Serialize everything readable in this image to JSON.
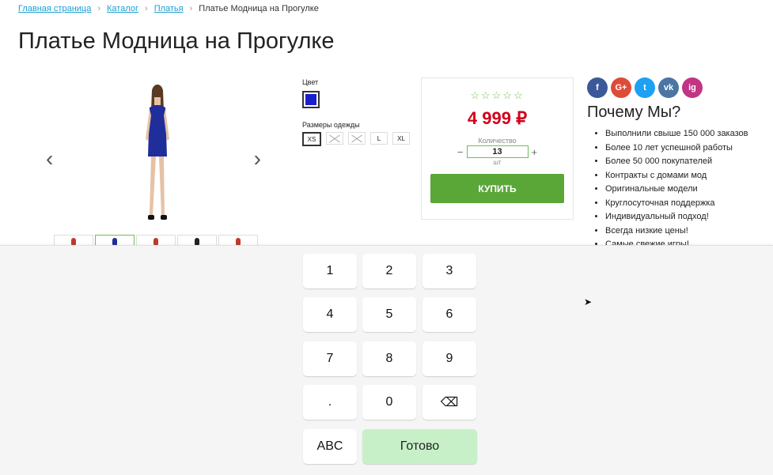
{
  "breadcrumb": {
    "home": "Главная страница",
    "catalog": "Каталог",
    "dresses": "Платья",
    "current": "Платье Модница на Прогулке"
  },
  "title": "Платье Модница на Прогулке",
  "options": {
    "color_label": "Цвет",
    "size_label": "Размеры одежды",
    "sizes": [
      "XS",
      "",
      "",
      "L",
      "XL"
    ]
  },
  "buybox": {
    "stars": "☆☆☆☆☆",
    "price": "4 999 ₽",
    "qty_label": "Количество",
    "qty_value": "13",
    "qty_unit": "шт",
    "buy": "КУПИТЬ"
  },
  "social": [
    "f",
    "G+",
    "t",
    "vk",
    "ig"
  ],
  "why": {
    "title": "Почему Мы?",
    "items": [
      "Выполнили свыше 150 000 заказов",
      "Более 10 лет успешной работы",
      "Более 50 000 покупателей",
      "Контракты с домами мод",
      "Оригинальные модели",
      "Круглосуточная поддержка",
      "Индивидуальный подход!",
      "Всегда низкие цены!",
      "Самые свежие игры!"
    ]
  },
  "keyboard": {
    "keys": [
      "1",
      "2",
      "3",
      "4",
      "5",
      "6",
      "7",
      "8",
      "9",
      ".",
      "0",
      "⌫"
    ],
    "abc": "ABC",
    "done": "Готово"
  },
  "colors": {
    "accent": "#5aa637",
    "price": "#d0021b",
    "swatch": "#1a1fcc"
  }
}
